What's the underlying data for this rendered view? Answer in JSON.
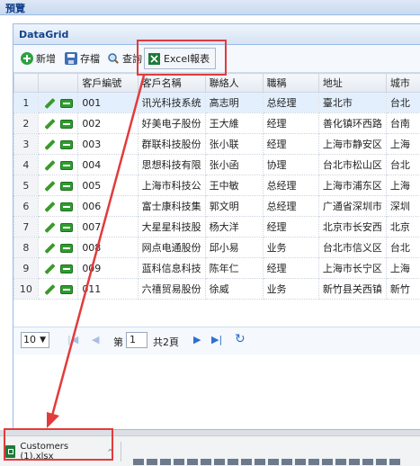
{
  "window_title": "預覽",
  "panel_title": "DataGrid",
  "toolbar": {
    "add_label": "新增",
    "save_label": "存檔",
    "search_label": "查詢",
    "excel_label": "Excel報表"
  },
  "columns": [
    "",
    "",
    "客戶編號",
    "客戶名稱",
    "聯絡人",
    "職稱",
    "地址",
    "城市"
  ],
  "rows": [
    {
      "n": "1",
      "id": "001",
      "name": "讯光科技系统",
      "contact": "高志明",
      "title": "总经理",
      "addr": "臺北市",
      "city": "台北"
    },
    {
      "n": "2",
      "id": "002",
      "name": "好美电子股份",
      "contact": "王大維",
      "title": "经理",
      "addr": "善化镇环西路",
      "city": "台南"
    },
    {
      "n": "3",
      "id": "003",
      "name": "群联科技股份",
      "contact": "张小联",
      "title": "经理",
      "addr": "上海市静安区",
      "city": "上海"
    },
    {
      "n": "4",
      "id": "004",
      "name": "思想科技有限",
      "contact": "张小函",
      "title": "协理",
      "addr": "台北市松山区",
      "city": "台北"
    },
    {
      "n": "5",
      "id": "005",
      "name": "上海市科技公",
      "contact": "王中敏",
      "title": "总经理",
      "addr": "上海市浦东区",
      "city": "上海"
    },
    {
      "n": "6",
      "id": "006",
      "name": "富士康科技集",
      "contact": "郭文明",
      "title": "总经理",
      "addr": "广通省深圳市",
      "city": "深圳"
    },
    {
      "n": "7",
      "id": "007",
      "name": "大星星科技股",
      "contact": "杨大洋",
      "title": "经理",
      "addr": "北京市长安西",
      "city": "北京"
    },
    {
      "n": "8",
      "id": "008",
      "name": "网点电通股份",
      "contact": "邱小易",
      "title": "业务",
      "addr": "台北市信义区",
      "city": "台北"
    },
    {
      "n": "9",
      "id": "009",
      "name": "蓝科信息科技",
      "contact": "陈年仁",
      "title": "经理",
      "addr": "上海市长宁区",
      "city": "上海"
    },
    {
      "n": "10",
      "id": "011",
      "name": "六禧贸易股份",
      "contact": "徐威",
      "title": "业务",
      "addr": "新竹县关西镇",
      "city": "新竹"
    }
  ],
  "pager": {
    "page_size": "10",
    "page_prefix": "第",
    "page_value": "1",
    "page_total": "共2頁"
  },
  "download": {
    "filename": "Customers (1).xlsx"
  },
  "colors": {
    "highlight": "#e23b3b",
    "header_text": "#15428b",
    "excel_green": "#1f7a3a"
  }
}
